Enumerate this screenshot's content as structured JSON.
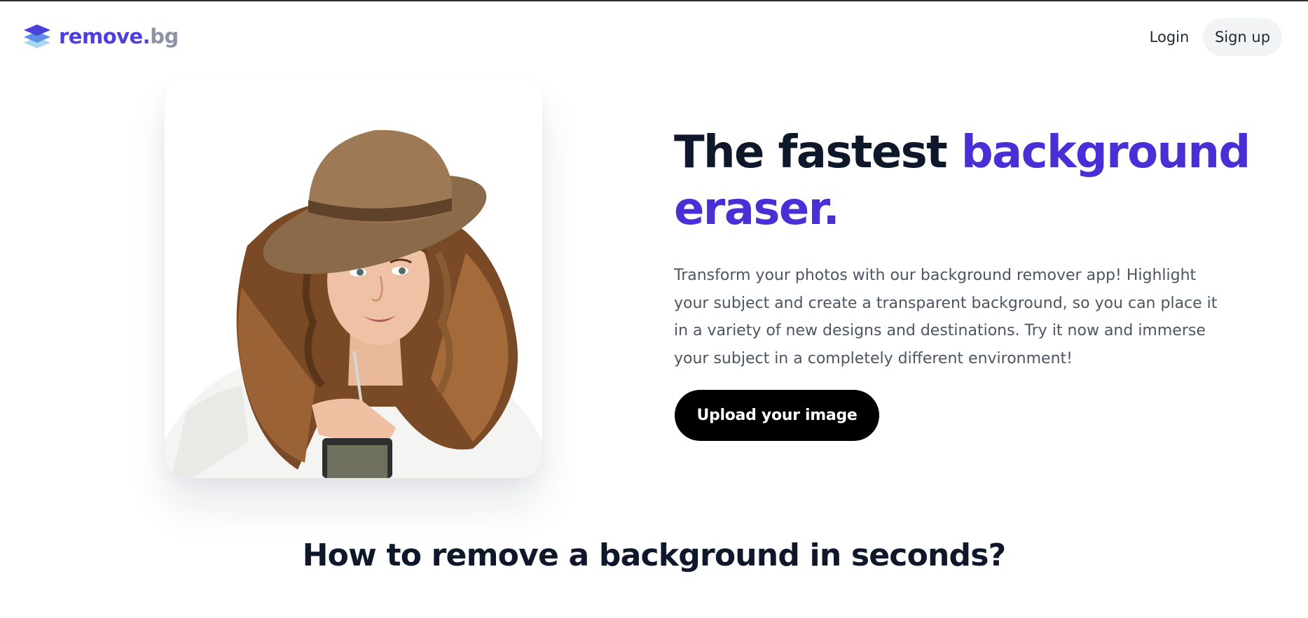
{
  "brand": {
    "name_main": "remove.",
    "name_suffix": "bg",
    "logo_icon": "stacked-layers-icon",
    "colors": {
      "primary": "#4e3fdc",
      "suffix": "#8a94a6",
      "accent": "#4a2fd6"
    }
  },
  "nav": {
    "login_label": "Login",
    "signup_label": "Sign up"
  },
  "hero": {
    "image_alt": "woman with curly hair wearing a straw hat holding a drink cup",
    "headline_part1": "The fastest ",
    "headline_accent": "background eraser.",
    "description": "Transform your photos with our background remover app! Highlight your subject and create a transparent background, so you can place it in a variety of new designs and destinations. Try it now and immerse your subject in a completely different environment!",
    "cta_label": "Upload your image"
  },
  "section": {
    "title": "How to remove a background in seconds?"
  }
}
